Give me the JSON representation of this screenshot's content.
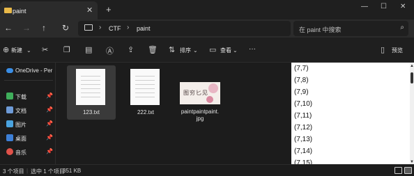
{
  "window": {
    "tab_title": "paint",
    "minimize": "—",
    "maximize": "☐",
    "close": "✕"
  },
  "nav": {
    "back": "←",
    "forward": "→",
    "up": "↑",
    "refresh": "↻"
  },
  "address": {
    "crumbs": [
      "CTF",
      "paint"
    ],
    "separator": "›"
  },
  "search": {
    "placeholder": "在 paint 中搜索"
  },
  "toolbar": {
    "new_label": "新建",
    "sort_label": "排序",
    "view_label": "查看",
    "more": "···",
    "preview_label": "预览"
  },
  "sidebar": {
    "items": [
      {
        "label": "OneDrive - Per",
        "icon": "cloud-icon",
        "color": "#3a8ee6"
      },
      {
        "label": "下载",
        "icon": "download-icon",
        "color": "#3fae5b"
      },
      {
        "label": "文档",
        "icon": "document-icon",
        "color": "#6e9bd8"
      },
      {
        "label": "图片",
        "icon": "picture-icon",
        "color": "#4aa3df"
      },
      {
        "label": "桌面",
        "icon": "desktop-icon",
        "color": "#3d7fd6"
      },
      {
        "label": "音乐",
        "icon": "music-icon",
        "color": "#e0524a"
      }
    ]
  },
  "files": [
    {
      "name": "123.txt",
      "type": "text",
      "selected": true
    },
    {
      "name": "222.txt",
      "type": "text",
      "selected": false
    },
    {
      "name": "paintpaintpaint.\njpg",
      "type": "image",
      "selected": false,
      "thumb_text": "图穷匕见"
    }
  ],
  "preview": {
    "lines": [
      "(7,7)",
      "(7,8)",
      "(7,9)",
      "(7,10)",
      "(7,11)",
      "(7,12)",
      "(7,13)",
      "(7,14)",
      "(7,15)"
    ]
  },
  "status": {
    "count": "3 个项目",
    "selected": "选中 1 个项目",
    "size": "351 KB"
  }
}
